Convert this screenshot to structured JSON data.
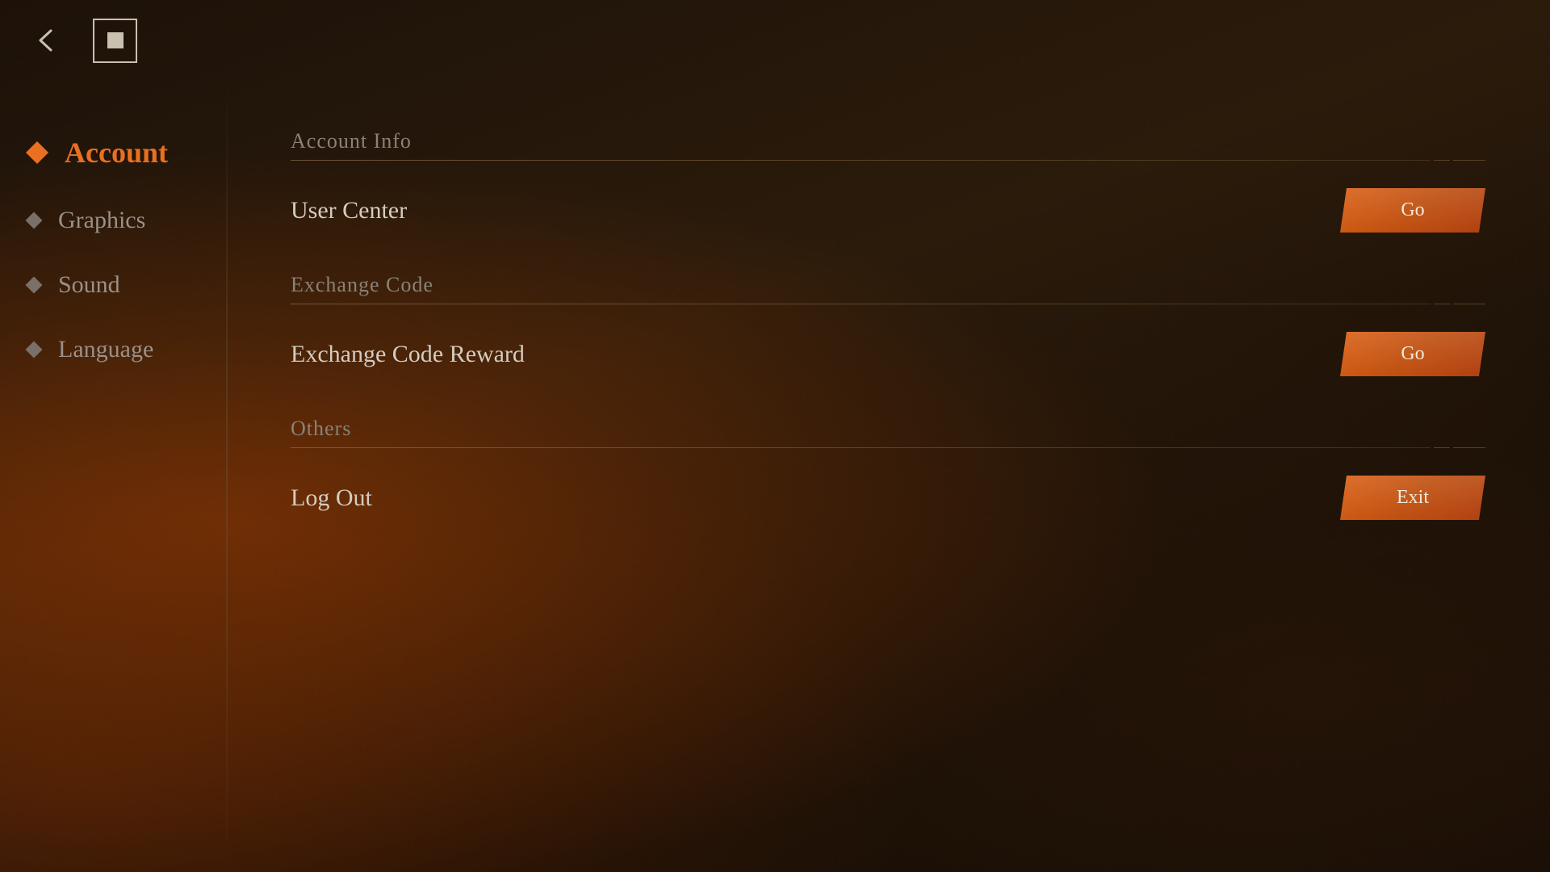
{
  "topbar": {
    "back_label": "back",
    "home_label": "home"
  },
  "sidebar": {
    "items": [
      {
        "id": "account",
        "label": "Account",
        "active": true
      },
      {
        "id": "graphics",
        "label": "Graphics",
        "active": false
      },
      {
        "id": "sound",
        "label": "Sound",
        "active": false
      },
      {
        "id": "language",
        "label": "Language",
        "active": false
      }
    ]
  },
  "main": {
    "sections": [
      {
        "id": "account-info",
        "title": "Account Info",
        "rows": [
          {
            "label": "User Center",
            "button": "Go"
          }
        ]
      },
      {
        "id": "exchange-code",
        "title": "Exchange Code",
        "rows": [
          {
            "label": "Exchange Code Reward",
            "button": "Go"
          }
        ]
      },
      {
        "id": "others",
        "title": "Others",
        "rows": [
          {
            "label": "Log Out",
            "button": "Exit"
          }
        ]
      }
    ]
  },
  "icons": {
    "back": "‹",
    "home": "■",
    "diamond": "◆"
  }
}
